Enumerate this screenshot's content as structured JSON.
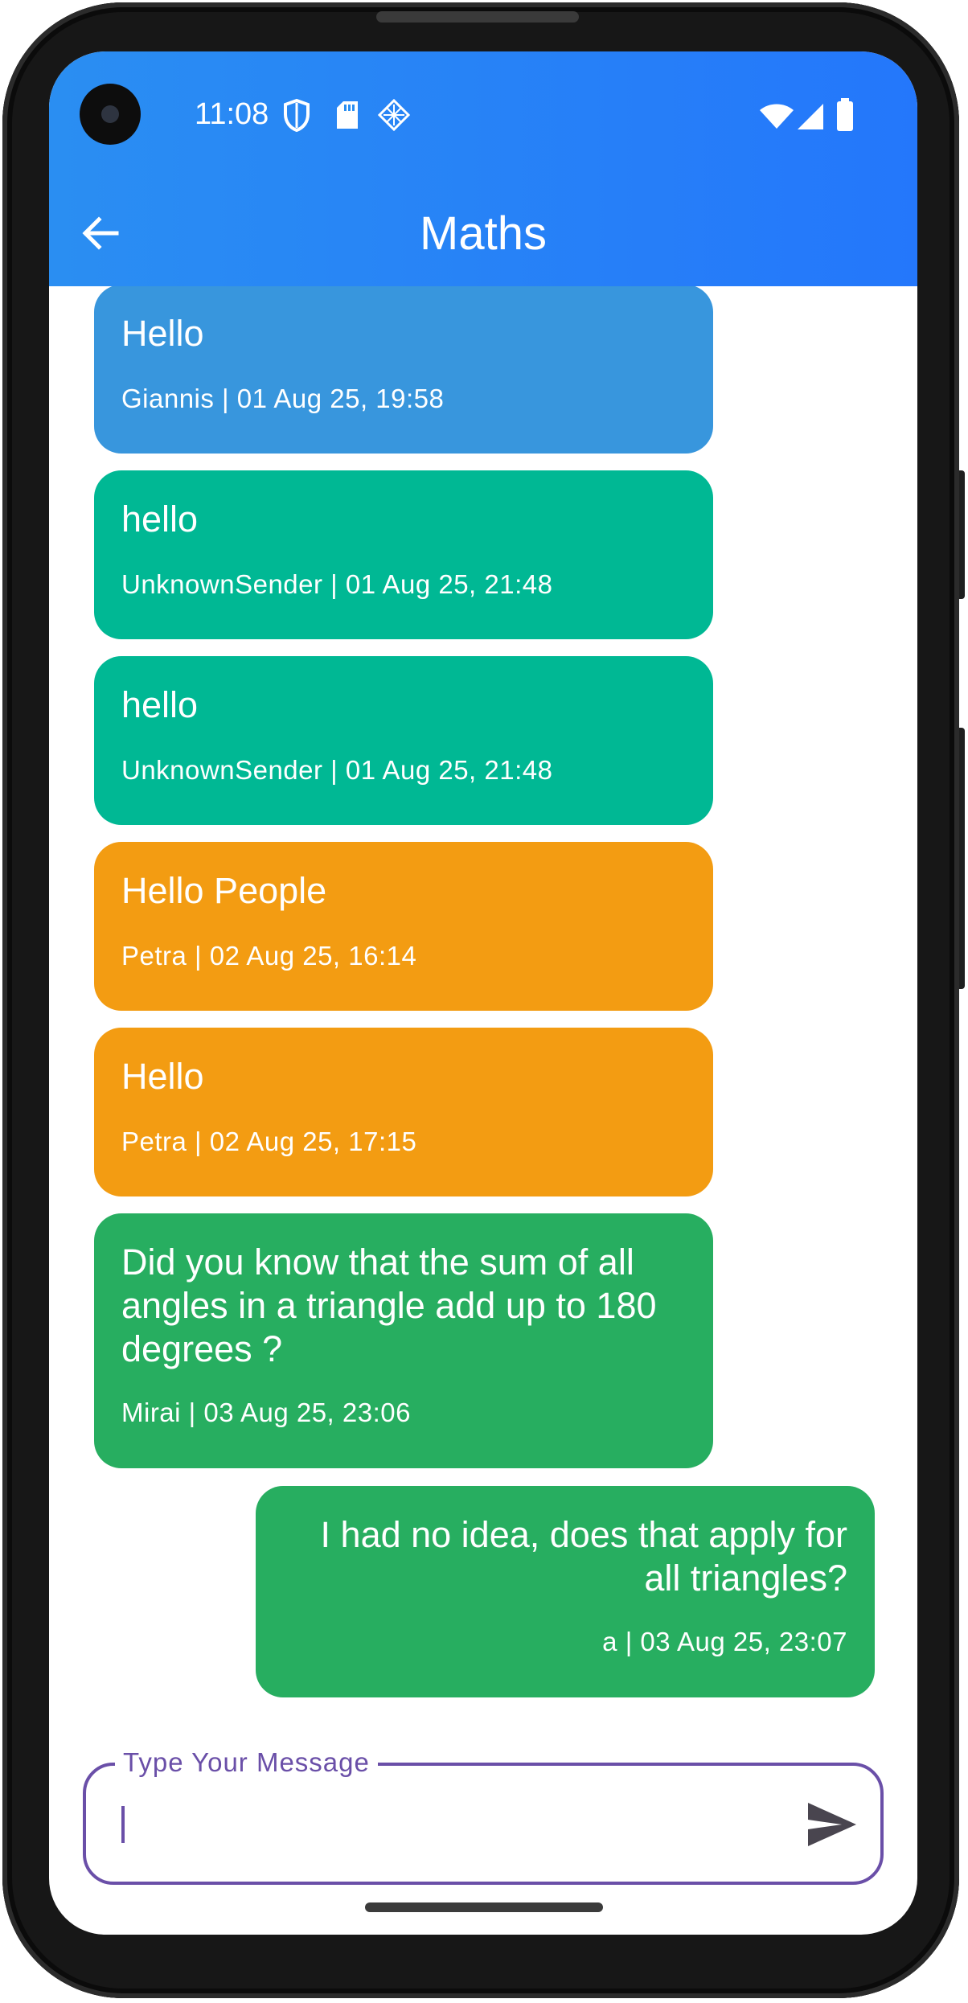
{
  "status_bar": {
    "time": "11:08",
    "icons": [
      "shield-icon",
      "sd-card-icon",
      "diamond-grid-icon",
      "wifi-icon",
      "signal-icon",
      "battery-icon"
    ]
  },
  "header": {
    "title": "Maths",
    "back_icon": "arrow-left-icon",
    "background": "#2a8ef2"
  },
  "messages": [
    {
      "text": "Hello",
      "meta": "Giannis | 01 Aug 25, 19:58",
      "align": "left",
      "color": "#3896dd"
    },
    {
      "text": "hello",
      "meta": "UnknownSender | 01 Aug 25, 21:48",
      "align": "left",
      "color": "#00b894"
    },
    {
      "text": "hello",
      "meta": "UnknownSender | 01 Aug 25, 21:48",
      "align": "left",
      "color": "#00b894"
    },
    {
      "text": "Hello People",
      "meta": "Petra | 02 Aug 25, 16:14",
      "align": "left",
      "color": "#f39c12"
    },
    {
      "text": "Hello",
      "meta": "Petra | 02 Aug 25, 17:15",
      "align": "left",
      "color": "#f39c12"
    },
    {
      "text": "Did you know that the sum of all angles in a triangle add up to 180 degrees ?",
      "meta": "Mirai | 03 Aug 25, 23:06",
      "align": "left",
      "color": "#27ae60"
    },
    {
      "text": "I had no idea, does that apply for all triangles?",
      "meta": "a | 03 Aug 25, 23:07",
      "align": "right",
      "color": "#27ae60"
    }
  ],
  "composer": {
    "label": "Type Your Message",
    "value": "",
    "send_icon": "send-icon",
    "accent": "#6a4fa8"
  }
}
